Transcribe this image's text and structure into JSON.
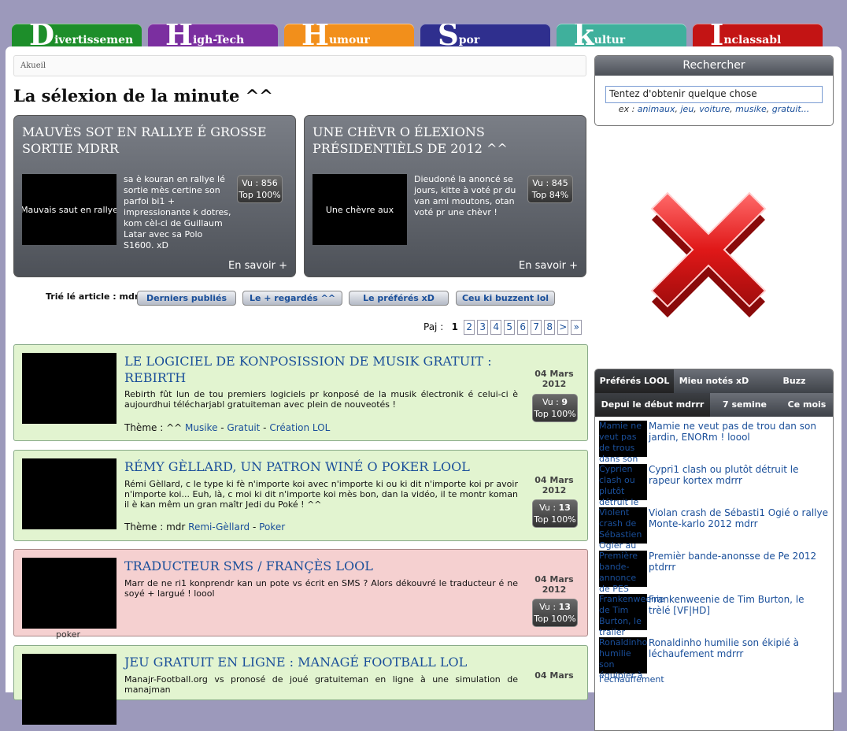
{
  "nav": {
    "categories": [
      {
        "first": "D",
        "rest": "ivertissemen",
        "color": "#1d8e2a"
      },
      {
        "first": "H",
        "rest": "igh-Tech",
        "color": "#7b2fa0"
      },
      {
        "first": "H",
        "rest": "umour",
        "color": "#f28f1b"
      },
      {
        "first": "S",
        "rest": "por",
        "color": "#2f2f8e"
      },
      {
        "first": "k",
        "rest": "ultur",
        "color": "#3fb09c"
      },
      {
        "first": "I",
        "rest": "nclassabl",
        "color": "#c31414"
      }
    ]
  },
  "breadcrumb": "Akueil",
  "page_title": "La sélexion de la minute ^^",
  "featured": [
    {
      "title": "Mauvès sot en rallye é grosse sortie mdrr",
      "thumb_alt": "Mauvais saut en rallye",
      "desc": "sa è kouran en rallye lé sortie mès certine son parfoi bi1 + impressionante k dotres, kom cèl-ci de Guillaum Latar avec sa Polo S1600. xD",
      "vu_label": "Vu : 856",
      "top_label": "Top 100%",
      "more": "En savoir +"
    },
    {
      "title": "Une chèvr o élexions présidentièls de 2012 ^^",
      "thumb_alt": "Une chèvre aux",
      "desc": "Dieudoné la anoncé se jours, kitte à voté pr du van ami moutons, otan voté pr une chèvr !",
      "vu_label": "Vu : 845",
      "top_label": "Top 84%",
      "more": "En savoir +"
    }
  ],
  "sort": {
    "label": "Trié lé article : mdr",
    "buttons": [
      "Derniers publiés",
      "Le + regardés ^^",
      "Le préférés xD",
      "Ceu ki buzzent lol"
    ]
  },
  "pager": {
    "label": "Paj :",
    "current": "1",
    "pages": [
      "2",
      "3",
      "4",
      "5",
      "6",
      "7",
      "8",
      ">",
      "»"
    ]
  },
  "articles": [
    {
      "title": "Le logiciel de konposission de musik gratuit : Rebirth",
      "text": "Rebirth fût lun de tou premiers logiciels pr konposé de la musik électronik é celui-ci è aujourdhui téléchar­jabl gratuiteman avec plein de nouveotés !",
      "theme_prefix": "Thème : ^^",
      "tags": [
        "Musike",
        "Gratuit",
        "Création LOL"
      ],
      "date_day": "04 Mars",
      "date_year": "2012",
      "vu_prefix": "Vu :",
      "vu": "9",
      "top": "Top 100%"
    },
    {
      "title": "Rémy Gèllard, un patron winé o poker lool",
      "text": "Rémi Gèllard, c le type ki fè n'importe koi avec n'importe ki ou ki dit n'importe koi pr avoir n'importe koi... Euh, là, c moi ki dit n'importe koi mès bon, dan la vidéo, il te montr koman il è kan mêm un gran maîtr Jedi du Poké ! ^^",
      "theme_prefix": "Thème : mdr",
      "tags": [
        "Remi-Gèllard",
        "Poker"
      ],
      "date_day": "04 Mars",
      "date_year": "2012",
      "vu_prefix": "Vu :",
      "vu": "13",
      "top": "Top 100%"
    },
    {
      "title": "Traducteur SMS / françès lool",
      "text": "Marr de ne ri1 konprendr kan un pote vs écrit en SMS ? Alors dékouvré le traducteur é ne soyé + largué ! loool",
      "date_day": "04 Mars",
      "date_year": "2012",
      "vu_prefix": "Vu :",
      "vu": "13",
      "top": "Top 100%"
    },
    {
      "title": "Jeu gratuit en ligne : managé football lol",
      "text": "Manajr-Football.org vs pronosé de joué gratuiteman en ligne à une simulation de manajman",
      "date_day": "04 Mars"
    }
  ],
  "under_label": "poker",
  "search": {
    "header": "Rechercher",
    "value": "Tentez d'obtenir quelque chose",
    "ex_prefix": "ex :",
    "examples": [
      "animaux",
      "jeu",
      "voiture",
      "musike",
      "gratuit..."
    ]
  },
  "side_tabs": {
    "row1": [
      "Préférés LOOL",
      "Mieu notés xD",
      "Buzz"
    ],
    "row2": [
      "Depui le début mdrrr",
      "7 semine",
      "Ce mois"
    ],
    "items": [
      {
        "thumb": "Mamie ne veut pas de trous dans son",
        "title": "Mamie ne veut pas de trou dan son jardin, ENORm ! loool"
      },
      {
        "thumb": "Cyprien clash ou plutôt détruit le",
        "title": "Cypri1 clash ou plutôt détruit le rapeur kortex mdrrr"
      },
      {
        "thumb": "Violent crash de Sébastien Ogier au",
        "title": "Violan crash de Sébasti1 Ogié o rallye Monte-karlo 2012 mdrr"
      },
      {
        "thumb": "Première bande-annonce de PES",
        "title": "Premièr bande-anonsse de Pe 2012 ptdrrr"
      },
      {
        "thumb": "Frankenweenie de Tim Burton, le trailer",
        "title": "Frankenweenie de Tim Burton, le trèlé [VF|HD]"
      },
      {
        "thumb": "Ronaldinho humilie son équipier à",
        "title": "Ronaldinho humilie son ékipié à léchaufement mdrrr"
      }
    ],
    "last_line": "l'echauffement"
  },
  "colors": {
    "accent_link": "#1a4f9a",
    "article_green": "#e2f4d0",
    "article_pink": "#f5d0d0",
    "x_red": "#e01818"
  }
}
